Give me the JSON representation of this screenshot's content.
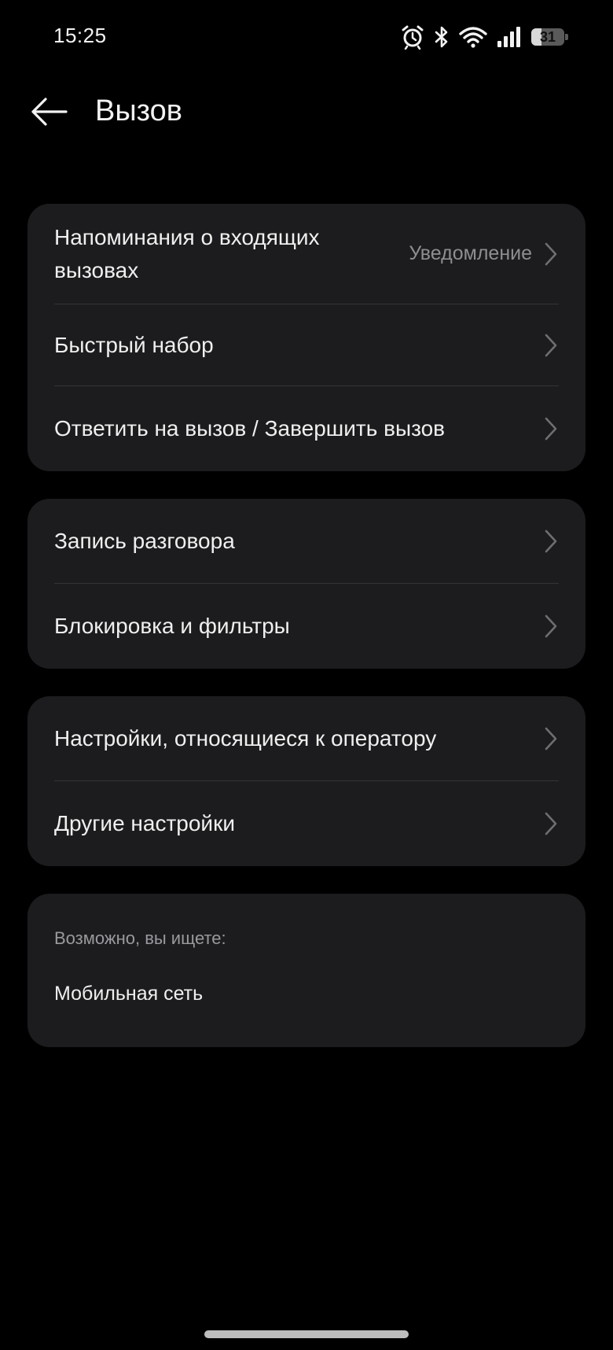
{
  "status_bar": {
    "time": "15:25",
    "battery_level": "31",
    "battery_percent": 31,
    "icons": [
      "alarm-icon",
      "bluetooth-icon",
      "wifi-icon",
      "signal-icon",
      "battery-icon"
    ]
  },
  "header": {
    "title": "Вызов",
    "back_icon": "arrow-left-icon"
  },
  "groups": [
    {
      "items": [
        {
          "label": "Напоминания о входящих вызовах",
          "value": "Уведомление"
        },
        {
          "label": "Быстрый набор"
        },
        {
          "label": "Ответить на вызов / Завершить вызов"
        }
      ]
    },
    {
      "items": [
        {
          "label": "Запись разговора"
        },
        {
          "label": "Блокировка и фильтры"
        }
      ]
    },
    {
      "items": [
        {
          "label": "Настройки, относящиеся к оператору"
        },
        {
          "label": "Другие настройки"
        }
      ]
    }
  ],
  "suggestions": {
    "header": "Возможно, вы ищете:",
    "items": [
      "Мобильная сеть"
    ]
  },
  "colors": {
    "background": "#000000",
    "card": "#1c1c1e",
    "text_primary": "#efefef",
    "text_secondary": "#8e8e92",
    "divider": "#343436"
  }
}
